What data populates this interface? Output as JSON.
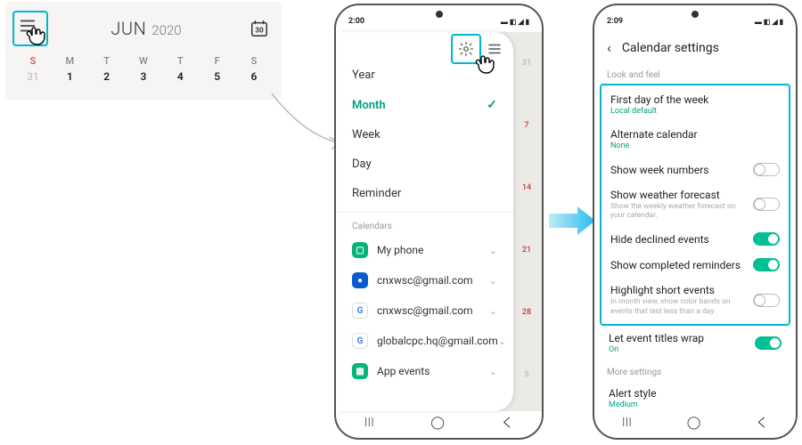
{
  "panel1": {
    "month": "JUN",
    "year": "2020",
    "weekdays": [
      "S",
      "M",
      "T",
      "W",
      "T",
      "F",
      "S"
    ],
    "dates": [
      "31",
      "1",
      "2",
      "3",
      "4",
      "5",
      "6"
    ],
    "today_badge": "30"
  },
  "phone2": {
    "time": "2:00",
    "views": [
      {
        "label": "Year",
        "selected": false
      },
      {
        "label": "Month",
        "selected": true
      },
      {
        "label": "Week",
        "selected": false
      },
      {
        "label": "Day",
        "selected": false
      },
      {
        "label": "Reminder",
        "selected": false
      }
    ],
    "calendars_label": "Calendars",
    "calendars": [
      {
        "label": "My phone",
        "icon": "phone",
        "color": "#06b37a"
      },
      {
        "label": "cnxwsc@gmail.com",
        "icon": "samsung",
        "color": "#0b5ad0"
      },
      {
        "label": "cnxwsc@gmail.com",
        "icon": "google",
        "color": "#fff"
      },
      {
        "label": "globalcpc.hq@gmail.com",
        "icon": "google",
        "color": "#fff"
      },
      {
        "label": "App events",
        "icon": "grid",
        "color": "#06b37a"
      }
    ],
    "day_slips": [
      "31",
      "7",
      "14",
      "21",
      "28",
      "5"
    ]
  },
  "phone3": {
    "time": "2:09",
    "title": "Calendar settings",
    "section1": "Look and feel",
    "rows_hl": [
      {
        "label": "First day of the week",
        "sub": "Local default",
        "sub_kind": "accent",
        "toggle": null
      },
      {
        "label": "Alternate calendar",
        "sub": "None",
        "sub_kind": "accent",
        "toggle": null
      },
      {
        "label": "Show week numbers",
        "toggle": false
      },
      {
        "label": "Show weather forecast",
        "desc": "Show the weekly weather forecast on your calendar.",
        "toggle": false
      },
      {
        "label": "Hide declined events",
        "toggle": true
      },
      {
        "label": "Show completed reminders",
        "toggle": true
      },
      {
        "label": "Highlight short events",
        "desc": "In month view, show color bands on events that last less than a day.",
        "toggle": false
      }
    ],
    "row_wrap": {
      "label": "Let event titles wrap",
      "sub": "On",
      "sub_kind": "accent",
      "toggle": true
    },
    "section2": "More settings",
    "row_alert": {
      "label": "Alert style",
      "sub": "Medium",
      "sub_kind": "accent"
    }
  }
}
